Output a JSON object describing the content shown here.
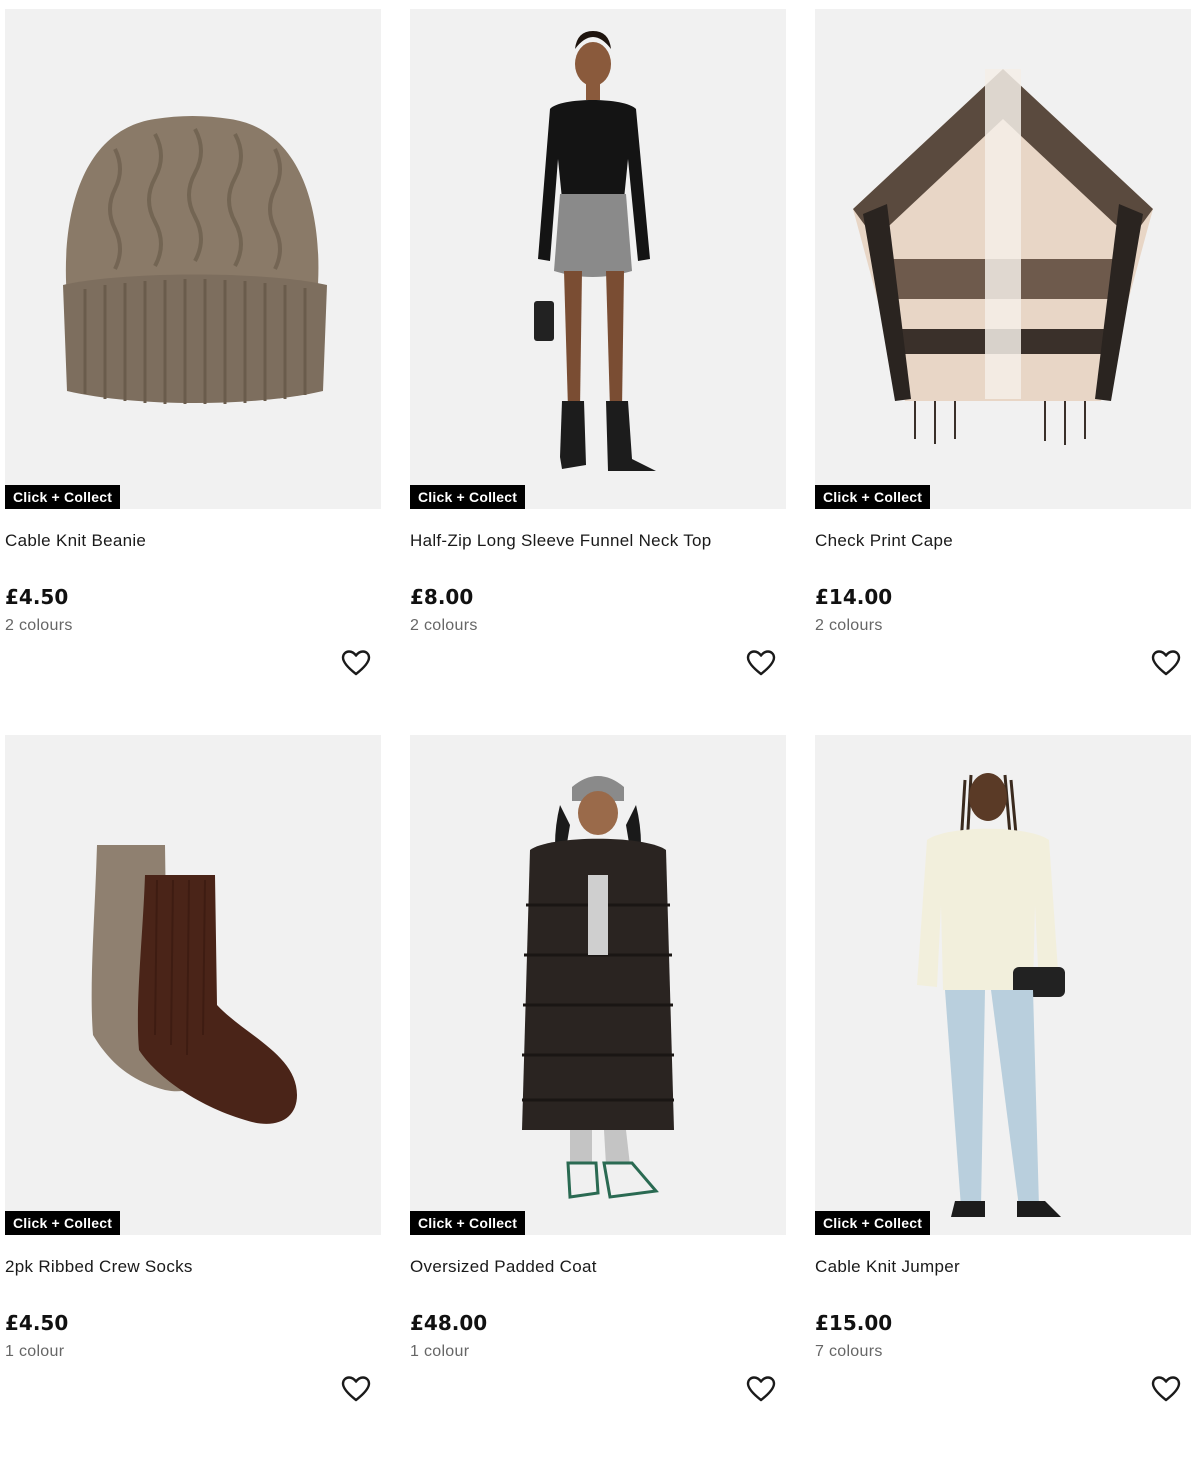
{
  "products": [
    {
      "name": "Cable Knit Beanie",
      "price": "£4.50",
      "colours": "2 colours",
      "badge": "Click + Collect",
      "image": "beanie"
    },
    {
      "name": "Half-Zip Long Sleeve Funnel Neck Top",
      "price": "£8.00",
      "colours": "2 colours",
      "badge": "Click + Collect",
      "image": "model-black-top"
    },
    {
      "name": "Check Print Cape",
      "price": "£14.00",
      "colours": "2 colours",
      "badge": "Click + Collect",
      "image": "cape"
    },
    {
      "name": "2pk Ribbed Crew Socks",
      "price": "£4.50",
      "colours": "1 colour",
      "badge": "Click + Collect",
      "image": "socks"
    },
    {
      "name": "Oversized Padded Coat",
      "price": "£48.00",
      "colours": "1 colour",
      "badge": "Click + Collect",
      "image": "model-padded-coat"
    },
    {
      "name": "Cable Knit Jumper",
      "price": "£15.00",
      "colours": "7 colours",
      "badge": "Click + Collect",
      "image": "model-cream-jumper"
    }
  ],
  "wishlist_icon": "heart-outline-icon",
  "colors": {
    "badge_bg": "#000000",
    "badge_text": "#ffffff",
    "image_bg": "#f1f1f1",
    "muted_text": "#666666"
  }
}
